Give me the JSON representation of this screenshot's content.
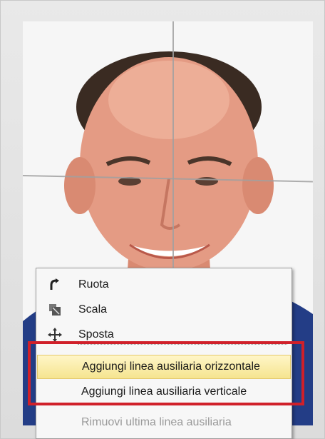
{
  "context_menu": {
    "items": [
      {
        "label": "Ruota",
        "icon": "rotate-icon"
      },
      {
        "label": "Scala",
        "icon": "scale-icon"
      },
      {
        "label": "Sposta",
        "icon": "move-icon"
      }
    ],
    "guide_items": [
      {
        "label": "Aggiungi linea ausiliaria orizzontale",
        "highlighted": true
      },
      {
        "label": "Aggiungi linea ausiliaria verticale",
        "highlighted": false
      }
    ],
    "disabled_item": {
      "label": "Rimuovi ultima linea ausiliaria"
    }
  },
  "colors": {
    "highlight_box": "#d0202a",
    "menu_hover": "#f5e48f"
  }
}
